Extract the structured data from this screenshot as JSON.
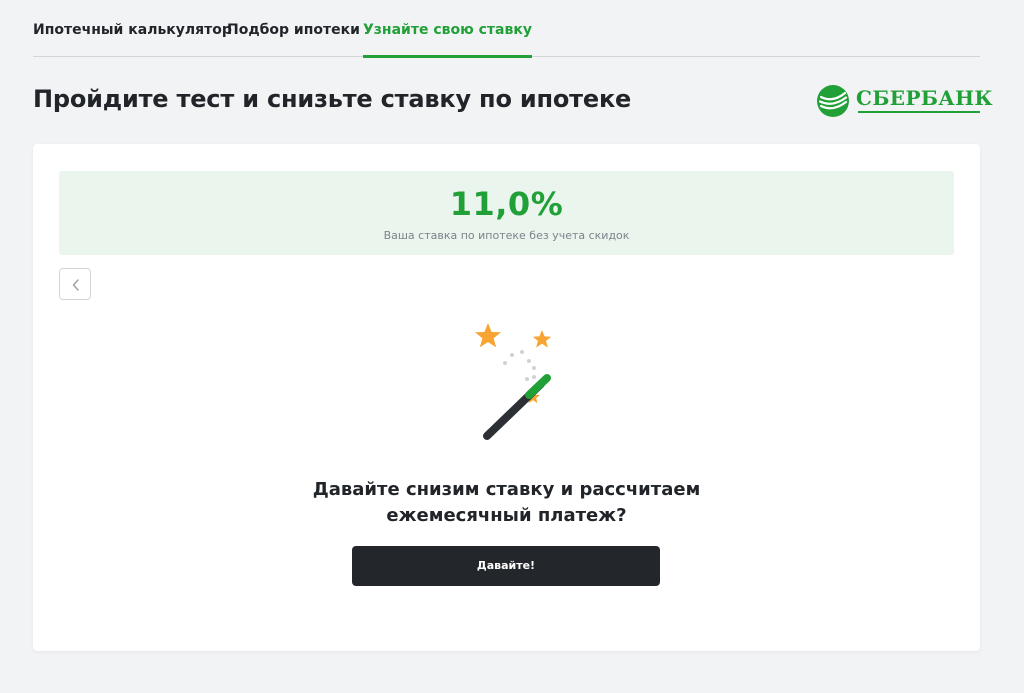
{
  "tabs": [
    {
      "label": "Ипотечный калькулятор",
      "active": false
    },
    {
      "label": "Подбор ипотеки",
      "active": false
    },
    {
      "label": "Узнайте свою ставку",
      "active": true
    }
  ],
  "header": {
    "title": "Пройдите тест и снизьте ставку по ипотеке",
    "logo_text": "СБЕРБАНК"
  },
  "rate": {
    "value": "11,0%",
    "caption": "Ваша ставка по ипотеке без учета скидок"
  },
  "question": {
    "line1": "Давайте снизим ставку и рассчитаем",
    "line2": "ежемесячный платеж?"
  },
  "cta": {
    "label": "Давайте!"
  },
  "icons": {
    "back": "chevron-left-icon",
    "illustration": "magic-wand-icon",
    "logo": "sberbank-logo-icon"
  },
  "colors": {
    "accent": "#21a038",
    "button": "#23262a",
    "rate_background": "#eaf5ee",
    "star": "#f7a432"
  }
}
